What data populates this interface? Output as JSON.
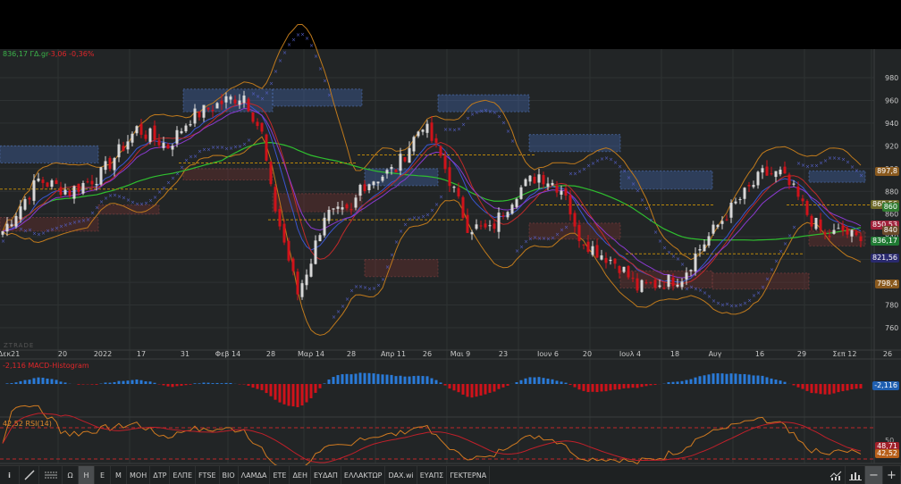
{
  "header": {
    "price": "836,17",
    "label": "ΓΔ.gr",
    "change": "-3,06",
    "change_pct": "-0,36%"
  },
  "brand": "ZTRADE",
  "price_axis": {
    "ticks": [
      980,
      960,
      940,
      920,
      900,
      880,
      860,
      840,
      820,
      800,
      780,
      760
    ],
    "tick_labels": [
      "980",
      "960",
      "940",
      "920",
      "900",
      "880",
      "860",
      "840",
      "820",
      "800",
      "780",
      "760"
    ]
  },
  "badges": [
    {
      "text": "897,8",
      "value": 897.8,
      "color": "#8a5a1e"
    },
    {
      "text": "868,56",
      "value": 868.56,
      "color": "#6e6a2a"
    },
    {
      "text": "860",
      "value": 866,
      "color": "#2f7a2f"
    },
    {
      "text": "850,53",
      "value": 850.53,
      "color": "#a0203a"
    },
    {
      "text": "840",
      "value": 846,
      "color": "#6a4a2a"
    },
    {
      "text": "836,17",
      "value": 836.17,
      "color": "#1f7a33"
    },
    {
      "text": "821,56",
      "value": 821.56,
      "color": "#2a2a6e"
    },
    {
      "text": "798,4",
      "value": 798.4,
      "color": "#8a5a1e"
    }
  ],
  "date_axis": [
    "Δεκ21",
    "20",
    "2022",
    "17",
    "31",
    "Φεβ 14",
    "28",
    "Μαρ 14",
    "28",
    "Απρ 11",
    "26",
    "Μαι 9",
    "23",
    "Ιουν 6",
    "20",
    "Ιουλ 4",
    "18",
    "Αυγ",
    "16",
    "29",
    "Σεπ 12",
    "26"
  ],
  "macd": {
    "label": "-2,116 MACD-Histogram",
    "badge": "-2,116"
  },
  "rsi": {
    "label": "42,52 RSI(14)",
    "axis_label": "50",
    "badge_signal": "48,71",
    "badge_value": "42,52"
  },
  "toolbar": {
    "items": [
      "Ω",
      "Η",
      "Ε",
      "Μ",
      "ΜΟΗ",
      "ΔΤΡ",
      "ΕΛΠΕ",
      "FTSE",
      "ΒΙΟ",
      "ΛΑΜΔΑ",
      "ΕΤΕ",
      "ΔΕΗ",
      "ΕΥΔΑΠ",
      "ΕΛΛΑΚΤΩΡ",
      "DAX.wi",
      "ΕΥΑΠΣ",
      "ΓΕΚΤΕΡΝΑ"
    ],
    "active": "Η",
    "icons": [
      "info-icon",
      "draw-line-icon",
      "indicators-icon"
    ],
    "right": [
      "chart-type-icon",
      "bar-chart-icon",
      "zoom-out-button",
      "zoom-in-button"
    ],
    "minus": "−",
    "plus": "+",
    "info": "i"
  },
  "chart_data": {
    "type": "candlestick",
    "ylim": [
      745,
      990
    ],
    "close_waypoints": [
      [
        0,
        845
      ],
      [
        8,
        890
      ],
      [
        15,
        880
      ],
      [
        22,
        895
      ],
      [
        30,
        935
      ],
      [
        37,
        920
      ],
      [
        42,
        945
      ],
      [
        50,
        960
      ],
      [
        54,
        965
      ],
      [
        58,
        930
      ],
      [
        60,
        880
      ],
      [
        66,
        790
      ],
      [
        69,
        820
      ],
      [
        72,
        860
      ],
      [
        78,
        860
      ],
      [
        80,
        885
      ],
      [
        88,
        900
      ],
      [
        94,
        940
      ],
      [
        98,
        910
      ],
      [
        101,
        880
      ],
      [
        104,
        850
      ],
      [
        109,
        845
      ],
      [
        115,
        880
      ],
      [
        120,
        895
      ],
      [
        126,
        880
      ],
      [
        128,
        845
      ],
      [
        132,
        830
      ],
      [
        138,
        815
      ],
      [
        142,
        795
      ],
      [
        148,
        800
      ],
      [
        152,
        805
      ],
      [
        156,
        830
      ],
      [
        162,
        860
      ],
      [
        170,
        895
      ],
      [
        174,
        895
      ],
      [
        177,
        880
      ],
      [
        180,
        860
      ],
      [
        184,
        840
      ],
      [
        188,
        845
      ],
      [
        192,
        836.17
      ]
    ]
  }
}
